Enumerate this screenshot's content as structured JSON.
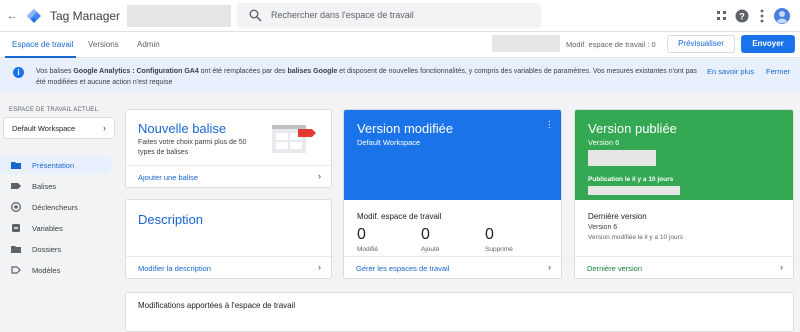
{
  "app": {
    "title": "Tag Manager"
  },
  "search": {
    "placeholder": "Rechercher dans l'espace de travail"
  },
  "tabs": [
    {
      "label": "Espace de travail"
    },
    {
      "label": "Versions"
    },
    {
      "label": "Admin"
    }
  ],
  "toolbar": {
    "modif_label": "Modif. espace de travail : 0",
    "preview_label": "Prévisualiser",
    "submit_label": "Envoyer"
  },
  "banner": {
    "text_1": "Vos balises ",
    "bold_1": "Google Analytics : Configuration GA4",
    "text_2": " ont été remplacées par des ",
    "bold_2": "balises Google",
    "text_3": " et disposent de nouvelles fonctionnalités, y compris des variables de paramètres. Vos mesures existantes n'ont pas été modifiées et aucune action n'est requise",
    "learn_more": "En savoir plus",
    "close": "Fermer"
  },
  "sidebar": {
    "workspace_label": "ESPACE DE TRAVAIL ACTUEL",
    "workspace_name": "Default Workspace",
    "items": [
      {
        "label": "Présentation",
        "icon": "folder-icon"
      },
      {
        "label": "Balises",
        "icon": "tag-icon"
      },
      {
        "label": "Déclencheurs",
        "icon": "trigger-icon"
      },
      {
        "label": "Variables",
        "icon": "variables-icon"
      },
      {
        "label": "Dossiers",
        "icon": "folder-icon"
      },
      {
        "label": "Modèles",
        "icon": "template-icon"
      }
    ]
  },
  "new_tag": {
    "title": "Nouvelle balise",
    "description": "Faites votre choix parmi plus de 50 types de balises",
    "link": "Ajouter une balise"
  },
  "description_card": {
    "title": "Description",
    "link": "Modifier la description"
  },
  "modified_version": {
    "title": "Version modifiée",
    "subtitle": "Default Workspace",
    "stats_title": "Modif. espace de travail",
    "stats": [
      {
        "value": "0",
        "label": "Modifié"
      },
      {
        "value": "0",
        "label": "Ajouté"
      },
      {
        "value": "0",
        "label": "Supprimé"
      }
    ],
    "link": "Gérer les espaces de travail"
  },
  "published_version": {
    "title": "Version publiée",
    "subtitle": "Version 6",
    "date": "Publication le il y a 10 jours",
    "last_title": "Dernière version",
    "last_name": "Version 6",
    "last_modified": "Version modifiée le il y a 10 jours",
    "link": "Dernière version"
  },
  "changes_card": {
    "title": "Modifications apportées à l'espace de travail"
  },
  "colors": {
    "accent": "#1a73e8",
    "green": "#34a853",
    "link": "#1967d2"
  }
}
